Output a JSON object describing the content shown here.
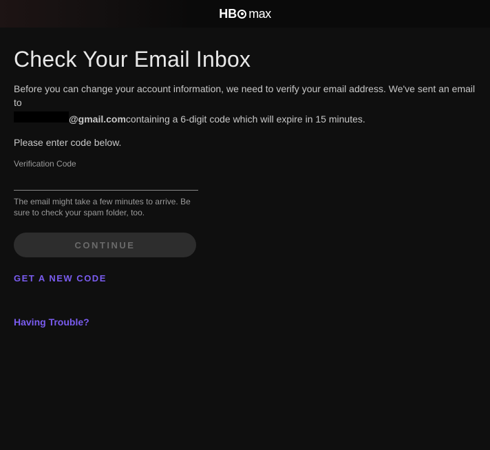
{
  "header": {
    "logo_brand": "HBO",
    "logo_suffix": "max"
  },
  "main": {
    "title": "Check Your Email Inbox",
    "description": "Before you can change your account information, we need to verify your email address. We've sent an email to",
    "email_domain": "@gmail.com",
    "email_suffix_text": " containing a 6-digit code which will expire in 15 minutes.",
    "instruction": "Please enter code below.",
    "field_label": "Verification Code",
    "code_value": "",
    "helper_text": "The email might take a few minutes to arrive. Be sure to check your spam folder, too.",
    "continue_label": "CONTINUE",
    "new_code_label": "GET A NEW CODE",
    "trouble_label": "Having Trouble?"
  }
}
